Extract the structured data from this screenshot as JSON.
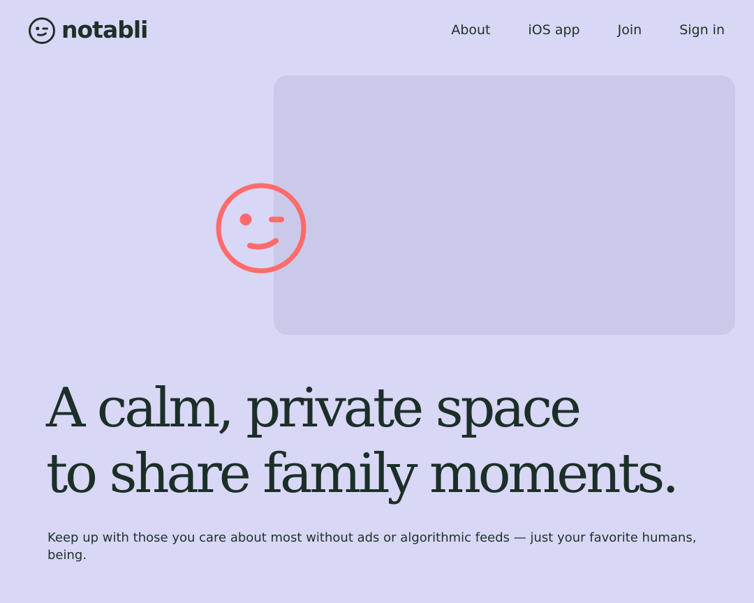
{
  "brand": {
    "name": "notabli",
    "accent_color": "#ff6b6b",
    "text_color": "#1e3029",
    "background_color": "#d8d7f5"
  },
  "nav": {
    "items": [
      {
        "label": "About"
      },
      {
        "label": "iOS app"
      },
      {
        "label": "Join"
      },
      {
        "label": "Sign in"
      }
    ]
  },
  "hero": {
    "headline_line1": "A calm, private space",
    "headline_line2": "to share family moments.",
    "subtext": "Keep up with those you care about most without ads or algorithmic feeds — just your favorite humans, being.",
    "graphic_icon": "wink-face-icon"
  }
}
